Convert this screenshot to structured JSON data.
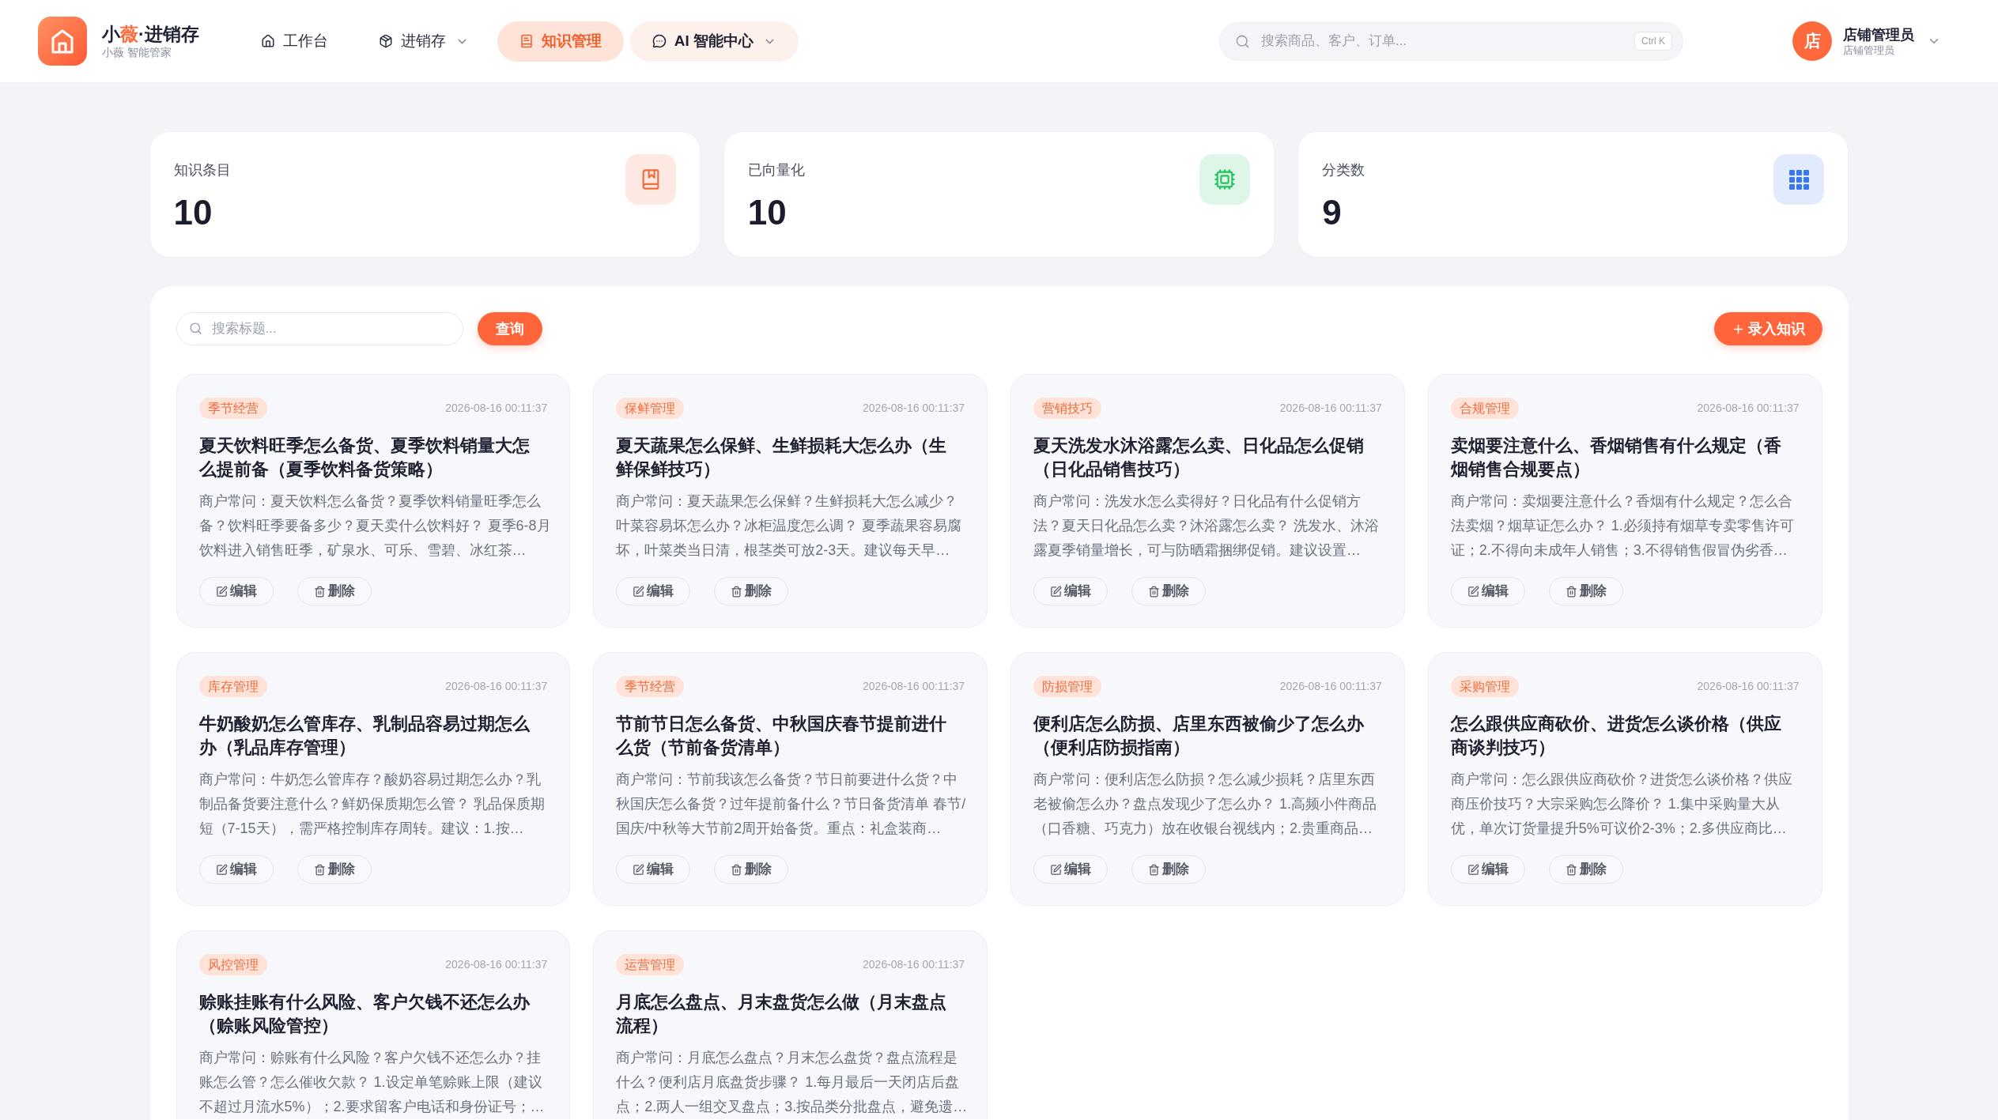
{
  "brand": {
    "title_parts": [
      {
        "text": "小",
        "accent": false
      },
      {
        "text": "薇",
        "accent": true
      },
      {
        "text": "·进销存",
        "accent": false
      }
    ],
    "subtitle": "小薇 智能管家"
  },
  "nav": [
    {
      "label": "工作台",
      "selected": false,
      "dropdown": false,
      "featured": false
    },
    {
      "label": "进销存",
      "selected": false,
      "dropdown": true,
      "featured": false
    },
    {
      "label": "知识管理",
      "selected": true,
      "dropdown": false,
      "featured": false
    },
    {
      "label": "AI 智能中心",
      "selected": false,
      "dropdown": true,
      "featured": true
    }
  ],
  "search": {
    "placeholder": "搜索商品、客户、订单...",
    "shortcut": "Ctrl K"
  },
  "user": {
    "avatar": "店",
    "name": "店铺管理员",
    "role": "店铺管理员"
  },
  "stats": [
    {
      "label": "知识条目",
      "value": "10",
      "color": "#f26b3a"
    },
    {
      "label": "已向量化",
      "value": "10",
      "color": "#22c55e"
    },
    {
      "label": "分类数",
      "value": "9",
      "color": "#3b78f0"
    }
  ],
  "toolbar": {
    "search_placeholder": "搜索标题...",
    "search_button": "查询",
    "add_button": "录入知识"
  },
  "cards": [
    {
      "category": "季节经营",
      "date": "2026-08-16 00:11:37",
      "title": "夏天饮料旺季怎么备货、夏季饮料销量大怎么提前备（夏季饮料备货策略）",
      "body": "商户常问：夏天饮料怎么备货？夏季饮料销量旺季怎么备？饮料旺季要备多少？夏天卖什么饮料好？ 夏季6-8月饮料进入销售旺季，矿泉水、可乐、雪碧、冰红茶…",
      "actions": [
        "编辑",
        "删除"
      ]
    },
    {
      "category": "保鲜管理",
      "date": "2026-08-16 00:11:37",
      "title": "夏天蔬果怎么保鲜、生鲜损耗大怎么办（生鲜保鲜技巧）",
      "body": "商户常问：夏天蔬果怎么保鲜？生鲜损耗大怎么减少？叶菜容易坏怎么办？冰柜温度怎么调？ 夏季蔬果容易腐坏，叶菜类当日清，根茎类可放2-3天。建议每天早…",
      "actions": [
        "编辑",
        "删除"
      ]
    },
    {
      "category": "营销技巧",
      "date": "2026-08-16 00:11:37",
      "title": "夏天洗发水沐浴露怎么卖、日化品怎么促销（日化品销售技巧）",
      "body": "商户常问：洗发水怎么卖得好？日化品有什么促销方法？夏天日化品怎么卖？沐浴露怎么卖？ 洗发水、沐浴露夏季销量增长，可与防晒霜捆绑促销。建议设置…",
      "actions": [
        "编辑",
        "删除"
      ]
    },
    {
      "category": "合规管理",
      "date": "2026-08-16 00:11:37",
      "title": "卖烟要注意什么、香烟销售有什么规定（香烟销售合规要点）",
      "body": "商户常问：卖烟要注意什么？香烟有什么规定？怎么合法卖烟？烟草证怎么办？ 1.必须持有烟草专卖零售许可证；2.不得向未成年人销售；3.不得销售假冒伪劣香…",
      "actions": [
        "编辑",
        "删除"
      ]
    },
    {
      "category": "库存管理",
      "date": "2026-08-16 00:11:37",
      "title": "牛奶酸奶怎么管库存、乳制品容易过期怎么办（乳品库存管理）",
      "body": "商户常问：牛奶怎么管库存？酸奶容易过期怎么办？乳制品备货要注意什么？鲜奶保质期怎么管？ 乳品保质期短（7-15天），需严格控制库存周转。建议：1.按…",
      "actions": [
        "编辑",
        "删除"
      ]
    },
    {
      "category": "季节经营",
      "date": "2026-08-16 00:11:37",
      "title": "节前节日怎么备货、中秋国庆春节提前进什么货（节前备货清单）",
      "body": "商户常问：节前我该怎么备货？节日前要进什么货？中秋国庆怎么备货？过年提前备什么？节日备货清单 春节/国庆/中秋等大节前2周开始备货。重点：礼盒装商…",
      "actions": [
        "编辑",
        "删除"
      ]
    },
    {
      "category": "防损管理",
      "date": "2026-08-16 00:11:37",
      "title": "便利店怎么防损、店里东西被偷少了怎么办（便利店防损指南）",
      "body": "商户常问：便利店怎么防损？怎么减少损耗？店里东西老被偷怎么办？盘点发现少了怎么办？ 1.高频小件商品（口香糖、巧克力）放在收银台视线内；2.贵重商品…",
      "actions": [
        "编辑",
        "删除"
      ]
    },
    {
      "category": "采购管理",
      "date": "2026-08-16 00:11:37",
      "title": "怎么跟供应商砍价、进货怎么谈价格（供应商谈判技巧）",
      "body": "商户常问：怎么跟供应商砍价？进货怎么谈价格？供应商压价技巧？大宗采购怎么降价？ 1.集中采购量大从优，单次订货量提升5%可议价2-3%；2.多供应商比…",
      "actions": [
        "编辑",
        "删除"
      ]
    },
    {
      "category": "风控管理",
      "date": "2026-08-16 00:11:37",
      "title": "赊账挂账有什么风险、客户欠钱不还怎么办（赊账风险管控）",
      "body": "商户常问：赊账有什么风险？客户欠钱不还怎么办？挂账怎么管？怎么催收欠款？ 1.设定单笔赊账上限（建议不超过月流水5%）；2.要求留客户电话和身份证号；…"
    },
    {
      "category": "运营管理",
      "date": "2026-08-16 00:11:37",
      "title": "月底怎么盘点、月末盘货怎么做（月末盘点流程）",
      "body": "商户常问：月底怎么盘点？月末怎么盘货？盘点流程是什么？便利店月底盘货步骤？ 1.每月最后一天闭店后盘点；2.两人一组交叉盘点；3.按品类分批盘点，避免遗…"
    }
  ]
}
